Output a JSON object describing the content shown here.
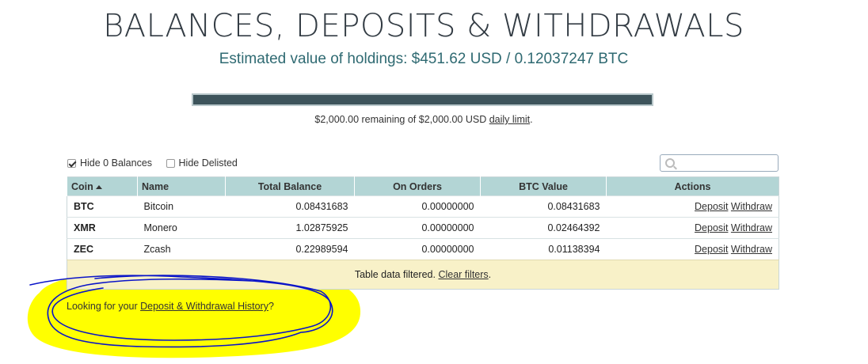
{
  "header": {
    "title": "BALANCES, DEPOSITS & WITHDRAWALS",
    "estimate": "Estimated value of holdings: $451.62 USD / 0.12037247 BTC"
  },
  "limit": {
    "remaining_text": "$2,000.00 remaining of $2,000.00 USD ",
    "link_label": "daily limit",
    "suffix": ".",
    "used_fraction": 0
  },
  "filters": {
    "hide_zero": {
      "label": "Hide 0 Balances",
      "checked": true
    },
    "hide_delisted": {
      "label": "Hide Delisted",
      "checked": false
    }
  },
  "search": {
    "placeholder": "",
    "icon": "search-icon"
  },
  "table": {
    "headers": [
      "Coin",
      "Name",
      "Total Balance",
      "On Orders",
      "BTC Value",
      "Actions"
    ],
    "rows": [
      {
        "coin": "BTC",
        "name": "Bitcoin",
        "total": "0.08431683",
        "orders": "0.00000000",
        "btc": "0.08431683"
      },
      {
        "coin": "XMR",
        "name": "Monero",
        "total": "1.02875925",
        "orders": "0.00000000",
        "btc": "0.02464392"
      },
      {
        "coin": "ZEC",
        "name": "Zcash",
        "total": "0.22989594",
        "orders": "0.00000000",
        "btc": "0.01138394"
      }
    ],
    "actions": {
      "deposit": "Deposit",
      "withdraw": "Withdraw"
    },
    "filtered_text": "Table data filtered. ",
    "clear_filters": "Clear filters",
    "filtered_suffix": "."
  },
  "history": {
    "prefix": "Looking for your ",
    "link": "Deposit & Withdrawal History",
    "suffix": "?"
  },
  "colors": {
    "header_bg": "#b3d5d5",
    "limit_bar": "#3d545b",
    "filter_notice_bg": "#f8f1c8",
    "highlight_yellow": "#ffff00",
    "annotation_blue": "#0a14c8"
  }
}
